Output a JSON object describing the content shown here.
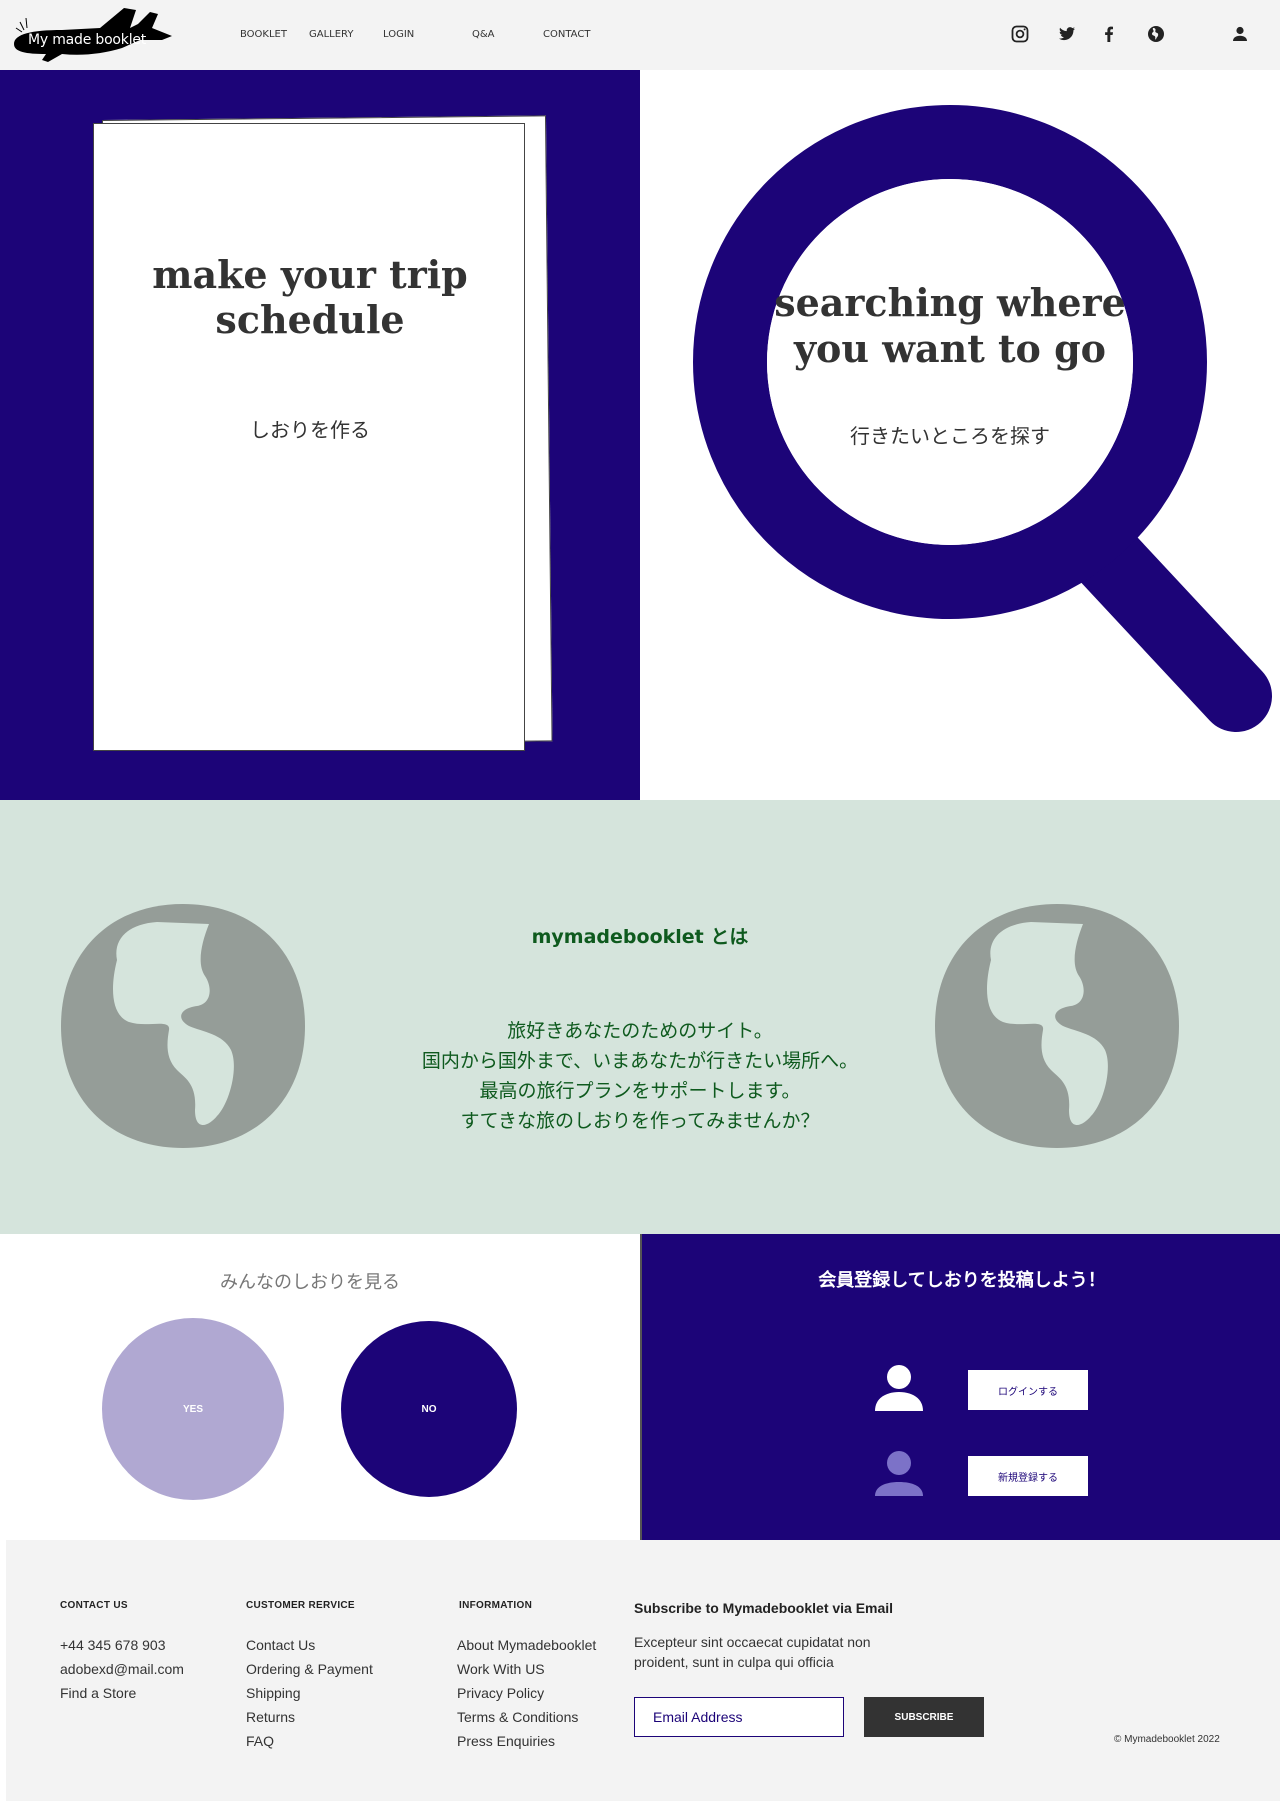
{
  "header": {
    "logo_text": "My made booklet",
    "nav": [
      "BOOKLET",
      "GALLERY",
      "LOGIN",
      "Q&A",
      "CONTACT"
    ],
    "social_icons": [
      "instagram-icon",
      "twitter-icon",
      "facebook-icon",
      "globe-icon"
    ],
    "account_icon": "user-icon"
  },
  "hero": {
    "booklet": {
      "title_line1": "make your trip",
      "title_line2": "schedule",
      "subtitle": "しおりを作る"
    },
    "search": {
      "title_line1": "searching where",
      "title_line2": "you want to go",
      "subtitle": "行きたいところを探す"
    }
  },
  "about": {
    "title": "mymadebooklet とは",
    "lines": [
      "旅好きあなたのためのサイト。",
      "国内から国外まで、いまあなたが行きたい場所へ。",
      "最高の旅行プランをサポートします。",
      "すてきな旅のしおりを作ってみませんか？"
    ]
  },
  "browse": {
    "title": "みんなのしおりを見る",
    "yes_label": "YES",
    "no_label": "NO"
  },
  "register": {
    "title": "会員登録してしおりを投稿しよう！",
    "login_label": "ログインする",
    "signup_label": "新規登録する"
  },
  "footer": {
    "contact": {
      "heading": "CONTACT US",
      "items": [
        "+44 345 678 903",
        "adobexd@mail.com",
        "Find a Store"
      ]
    },
    "customer": {
      "heading": "CUSTOMER RERVICE",
      "items": [
        "Contact Us",
        "Ordering & Payment",
        "Shipping",
        "Returns",
        "FAQ"
      ]
    },
    "information": {
      "heading": "INFORMATION",
      "items": [
        "About Mymadebooklet",
        "Work With US",
        "Privacy Policy",
        "Terms & Conditions",
        "Press Enquiries"
      ]
    },
    "subscribe": {
      "heading": "Subscribe to Mymadebooklet via Email",
      "description": "Excepteur sint occaecat cupidatat non proident, sunt in culpa qui officia",
      "placeholder": "Email Address",
      "button": "SUBSCRIBE"
    },
    "copyright": "© Mymadebooklet 2022"
  },
  "colors": {
    "brand_navy": "#1c0478",
    "mint_bg": "#d5e4dc",
    "globe_gray": "#959d98",
    "about_green": "#0e5a1e",
    "yes_lavender": "#b0a8d2",
    "footer_bg": "#f3f3f3"
  }
}
